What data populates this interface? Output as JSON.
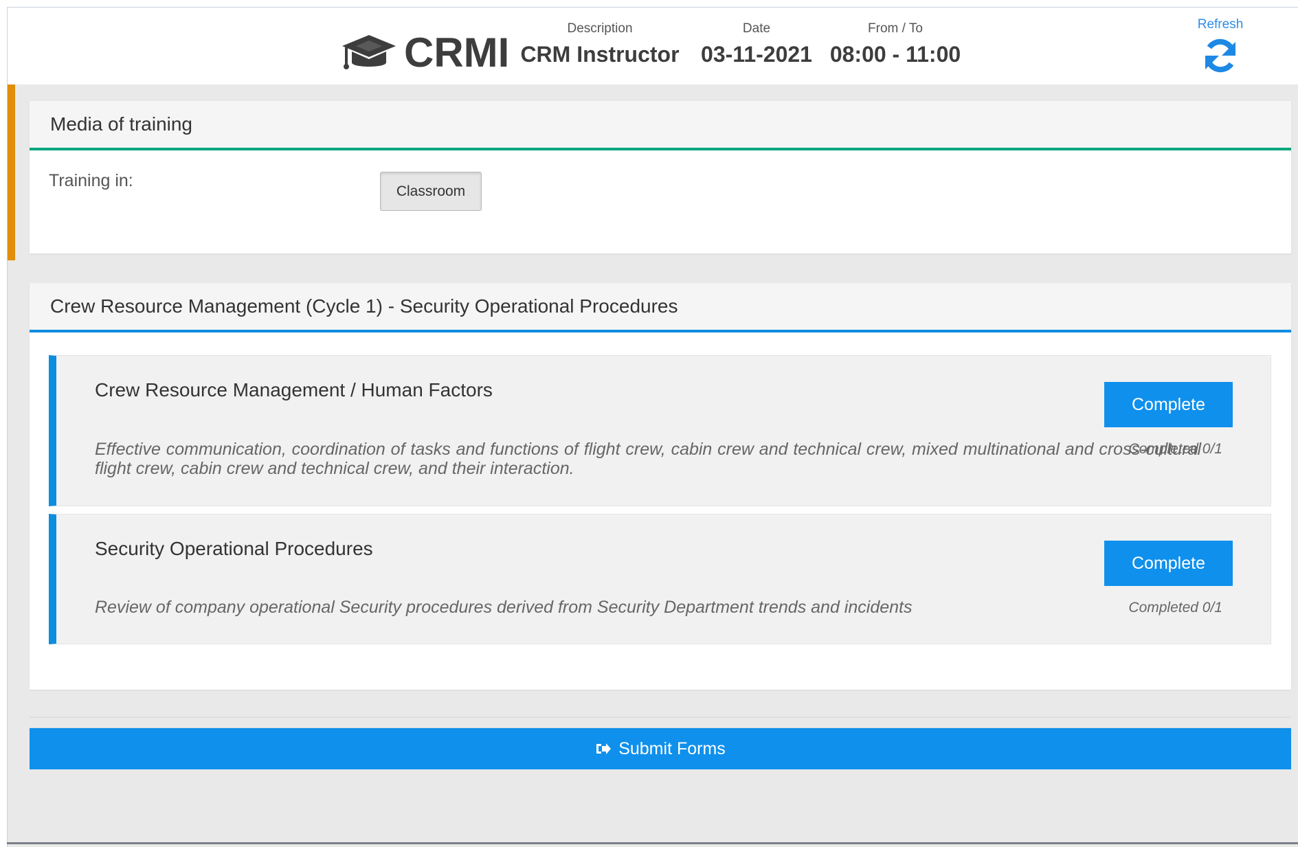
{
  "header": {
    "brand": "CRMI",
    "brand_icon": "graduation-cap-icon",
    "description_label": "Description",
    "description_value": "CRM Instructor",
    "date_label": "Date",
    "date_value": "03-11-2021",
    "time_label": "From / To",
    "time_value": "08:00 - 11:00",
    "refresh_label": "Refresh",
    "refresh_icon": "refresh-icon"
  },
  "media_panel": {
    "title": "Media of training",
    "training_label": "Training in:",
    "training_value": "Classroom"
  },
  "course_panel": {
    "title": "Crew Resource Management (Cycle 1) - Security Operational Procedures",
    "topics": [
      {
        "title": "Crew Resource Management / Human Factors",
        "description": "Effective communication, coordination of tasks and functions of flight crew, cabin crew and technical crew, mixed multinational and cross-cultural flight crew, cabin crew and technical crew, and their interaction.",
        "button_label": "Complete",
        "status": "Completed 0/1"
      },
      {
        "title": "Security Operational Procedures",
        "description": "Review of company operational Security procedures derived from Security Department trends and incidents",
        "button_label": "Complete",
        "status": "Completed 0/1"
      }
    ]
  },
  "footer": {
    "submit_label": "Submit Forms",
    "submit_icon": "sign-in-icon"
  },
  "colors": {
    "accent_orange": "#e08e0b",
    "primary_blue": "#0f90ec",
    "section_green": "#0aa67e",
    "refresh_blue": "#1e88e5"
  }
}
